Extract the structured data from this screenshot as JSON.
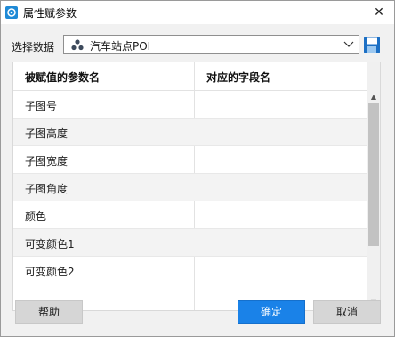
{
  "window": {
    "title": "属性赋参数",
    "close_glyph": "✕"
  },
  "datasource": {
    "label": "选择数据",
    "value": "汽车站点POI",
    "icon": "poi-dataset-icon"
  },
  "table": {
    "headers": [
      "被赋值的参数名",
      "对应的字段名"
    ],
    "rows": [
      {
        "param": "子图号",
        "field": ""
      },
      {
        "param": "子图高度",
        "field": ""
      },
      {
        "param": "子图宽度",
        "field": ""
      },
      {
        "param": "子图角度",
        "field": ""
      },
      {
        "param": "颜色",
        "field": ""
      },
      {
        "param": "可变颜色1",
        "field": ""
      },
      {
        "param": "可变颜色2",
        "field": ""
      }
    ]
  },
  "buttons": {
    "help": "帮助",
    "ok": "确定",
    "cancel": "取消"
  },
  "colors": {
    "accent": "#1a82e8",
    "title_icon": "#1f8ad6",
    "row_alt": "#f3f3f3"
  }
}
